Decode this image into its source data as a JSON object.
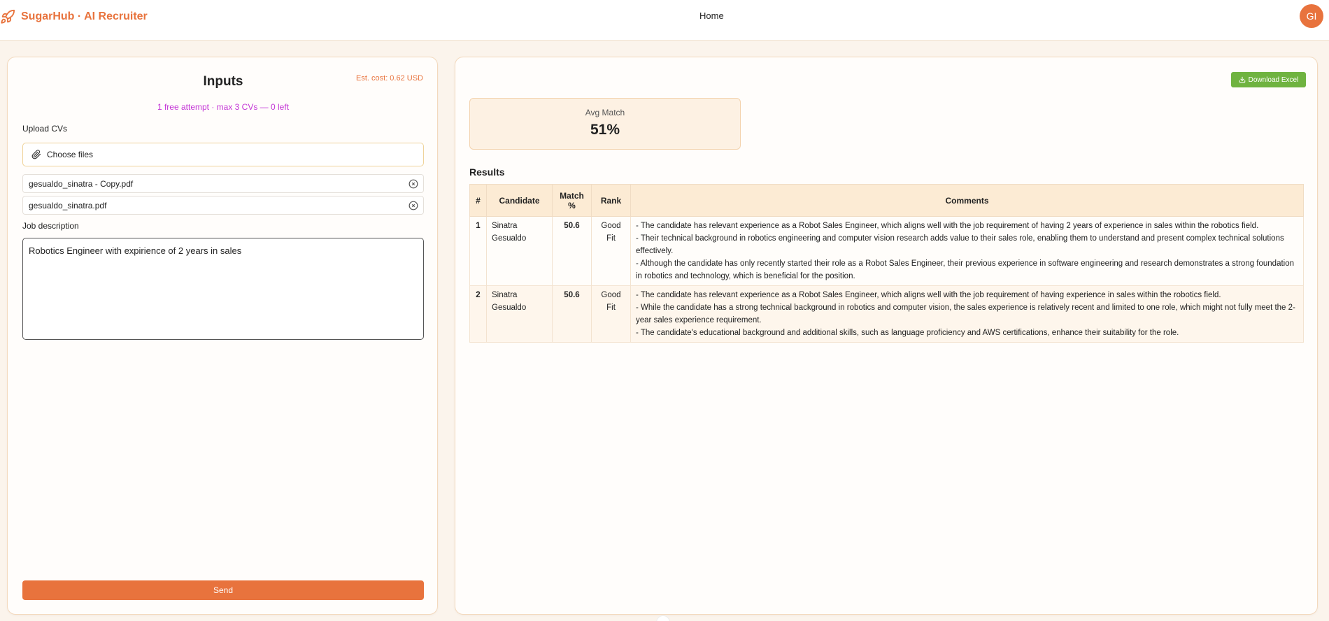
{
  "header": {
    "brand": "SugarHub · AI Recruiter",
    "brand_icon": "rocket-icon",
    "nav_home": "Home",
    "avatar_initials": "GI",
    "accent_color": "#e8733d"
  },
  "inputs": {
    "title": "Inputs",
    "est_cost": "Est. cost: 0.62 USD",
    "free_attempt": "1 free attempt · max 3 CVs — 0 left",
    "upload_label": "Upload CVs",
    "choose_files": "Choose files",
    "files": [
      {
        "name": "gesualdo_sinatra - Copy.pdf"
      },
      {
        "name": "gesualdo_sinatra.pdf"
      }
    ],
    "job_label": "Job description",
    "job_value": "Robotics Engineer with expirience of 2 years in sales",
    "send_label": "Send"
  },
  "results": {
    "download_label": "Download Excel",
    "avg_label": "Avg Match",
    "avg_value": "51%",
    "title": "Results",
    "columns": [
      "#",
      "Candidate",
      "Match %",
      "Rank",
      "Comments"
    ],
    "rows": [
      {
        "num": "1",
        "candidate": "Sinatra Gesualdo",
        "match": "50.6",
        "rank": "Good Fit",
        "comments": [
          "- The candidate has relevant experience as a Robot Sales Engineer, which aligns well with the job requirement of having 2 years of experience in sales within the robotics field.",
          "- Their technical background in robotics engineering and computer vision research adds value to their sales role, enabling them to understand and present complex technical solutions effectively.",
          "- Although the candidate has only recently started their role as a Robot Sales Engineer, their previous experience in software engineering and research demonstrates a strong foundation in robotics and technology, which is beneficial for the position."
        ]
      },
      {
        "num": "2",
        "candidate": "Sinatra Gesualdo",
        "match": "50.6",
        "rank": "Good Fit",
        "comments": [
          "- The candidate has relevant experience as a Robot Sales Engineer, which aligns well with the job requirement of having experience in sales within the robotics field.",
          "- While the candidate has a strong technical background in robotics and computer vision, the sales experience is relatively recent and limited to one role, which might not fully meet the 2-year sales experience requirement.",
          "- The candidate's educational background and additional skills, such as language proficiency and AWS certifications, enhance their suitability for the role."
        ]
      }
    ]
  }
}
